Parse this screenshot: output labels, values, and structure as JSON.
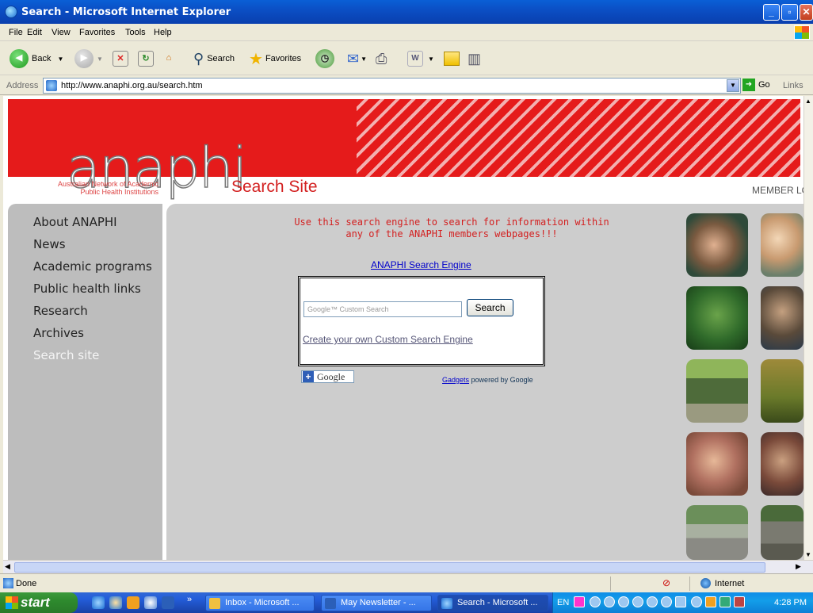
{
  "window": {
    "title": "Search - Microsoft Internet Explorer"
  },
  "menu": [
    "File",
    "Edit",
    "View",
    "Favorites",
    "Tools",
    "Help"
  ],
  "toolbar": {
    "back_label": "Back",
    "search_label": "Search",
    "favorites_label": "Favorites"
  },
  "address": {
    "label": "Address",
    "url": "http://www.anaphi.org.au/search.htm",
    "go_label": "Go",
    "links_label": "Links"
  },
  "site": {
    "logo_text": "anaphi",
    "tagline_line1": "Australian Network of Academic",
    "tagline_line2": "Public Health Institutions",
    "page_title": "Search Site",
    "member_login": "MEMBER LO"
  },
  "nav": {
    "items": [
      "About ANAPHI",
      "News",
      "Academic programs",
      "Public health links",
      "Research",
      "Archives",
      "Search site"
    ],
    "active": "Search site"
  },
  "content": {
    "intro_line1": "Use this search engine to search for information within",
    "intro_line2": "any of the ANAPHI members webpages!!!",
    "engine_link": "ANAPHI Search Engine",
    "search_placeholder": "Google™ Custom Search",
    "search_button": "Search",
    "create_link": "Create your own Custom Search Engine",
    "google_badge": "Google",
    "gadgets_link": "Gadgets",
    "powered_by": "powered by Google"
  },
  "status": {
    "text": "Done",
    "zone": "Internet"
  },
  "taskbar": {
    "start": "start",
    "items": [
      "Inbox - Microsoft ...",
      "May Newsletter - ...",
      "Search - Microsoft ..."
    ],
    "lang": "EN",
    "clock": "4:28 PM"
  },
  "colors": {
    "brand_red": "#e51b1b",
    "nav_gray": "#bdbdbd",
    "main_gray": "#cdcdcd"
  }
}
